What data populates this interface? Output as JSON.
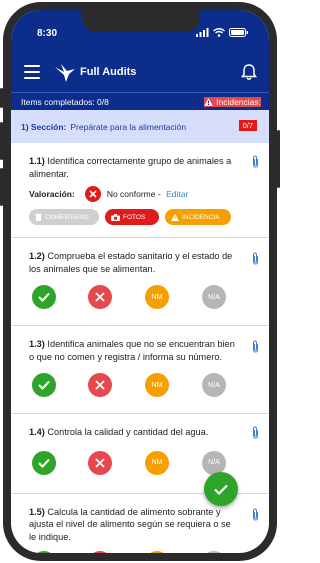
{
  "status": {
    "time": "8:30"
  },
  "app": {
    "title": "Full Audits"
  },
  "summary": {
    "completed": "Items completados: 0/8",
    "incidents": "Incidencias:"
  },
  "section": {
    "label": "1) Sección:",
    "title": "Prepárate para la alimentación",
    "count": "0/7"
  },
  "items": [
    {
      "num": "1.1)",
      "text": "Identifica correctamente grupo de animales a alimentar."
    },
    {
      "num": "1.2)",
      "text": "Comprueba el estado sanitario y el estado de los animales que se alimentan."
    },
    {
      "num": "1.3)",
      "text": "Identifica animales que no se encuentran bien o que no comen y registra / informa su número."
    },
    {
      "num": "1.4)",
      "text": "Controla la calidad y cantidad del agua."
    },
    {
      "num": "1.5)",
      "text": "Calcula la cantidad de alimento sobrante y ajusta el nivel de alimento según se requiera o se le indique."
    }
  ],
  "valoracion": {
    "label": "Valoración:",
    "value": "No conforme",
    "separator": " - ",
    "edit": "Editar"
  },
  "chips": {
    "comentario": "COMENTARIO",
    "fotos": "FOTOS",
    "incidencia": "INCIDENCIA"
  },
  "answer_labels": {
    "nm": "NM",
    "na": "N/A"
  },
  "colors": {
    "primary": "#0d2d8c",
    "section_bg": "#d6defa",
    "ok": "#2ea52a",
    "fail": "#e5484d",
    "nm": "#f6a000",
    "na": "#b5b5b5"
  }
}
